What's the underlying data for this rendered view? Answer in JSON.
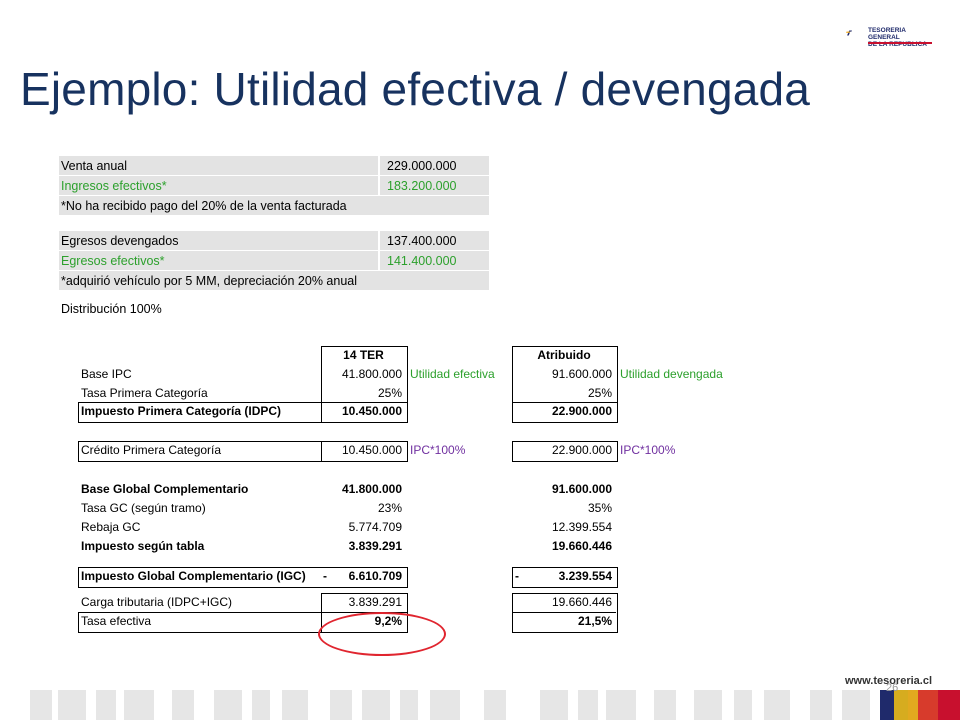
{
  "header": {
    "title": "Ejemplo: Utilidad efectiva / devengada",
    "logo_line1": "TESORERIA GENERAL",
    "logo_line2": "DE LA REPUBLICA"
  },
  "box1": {
    "r1_label": "Venta anual",
    "r1_value": "229.000.000",
    "r2_label": "Ingresos efectivos*",
    "r2_value": "183.200.000",
    "note": "*No ha recibido pago del 20% de la venta facturada"
  },
  "box2": {
    "r1_label": "Egresos devengados",
    "r1_value": "137.400.000",
    "r2_label": "Egresos efectivos*",
    "r2_value": "141.400.000",
    "note": "*adquirió vehículo por 5 MM, depreciación 20% anual"
  },
  "distribution": "Distribución  100%",
  "table": {
    "col1_header": "14 TER",
    "col2_header": "Atribuido",
    "rows": {
      "base_ipc": {
        "label": "Base IPC",
        "v1": "41.800.000",
        "v2": "91.600.000",
        "note1": "Utilidad efectiva",
        "note2": "Utilidad devengada"
      },
      "tasa_pc": {
        "label": "Tasa Primera Categoría",
        "v1": "25%",
        "v2": "25%"
      },
      "idpc": {
        "label": "Impuesto Primera Categoría (IDPC)",
        "v1": "10.450.000",
        "v2": "22.900.000"
      },
      "credito": {
        "label": "Crédito Primera Categoría",
        "v1": "10.450.000",
        "v2": "22.900.000",
        "note1": "IPC*100%",
        "note2": "IPC*100%"
      },
      "base_gc": {
        "label": "Base Global Complementario",
        "v1": "41.800.000",
        "v2": "91.600.000"
      },
      "tasa_gc": {
        "label": "Tasa GC (según tramo)",
        "v1": "23%",
        "v2": "35%"
      },
      "rebaja": {
        "label": "Rebaja GC",
        "v1": "5.774.709",
        "v2": "12.399.554"
      },
      "impuesto_tabla": {
        "label": "Impuesto según tabla",
        "v1": "3.839.291",
        "v2": "19.660.446"
      },
      "igc": {
        "label": "Impuesto Global Complementario (IGC)",
        "dash1": "-",
        "v1": "6.610.709",
        "dash2": "-",
        "v2": "3.239.554"
      },
      "carga": {
        "label": "Carga tributaria (IDPC+IGC)",
        "v1": "3.839.291",
        "v2": "19.660.446"
      },
      "tasa_ef": {
        "label": "Tasa efectiva",
        "v1": "9,2%",
        "v2": "21,5%"
      }
    }
  },
  "footer": {
    "url": "www.tesoreria.cl",
    "page": "26"
  }
}
